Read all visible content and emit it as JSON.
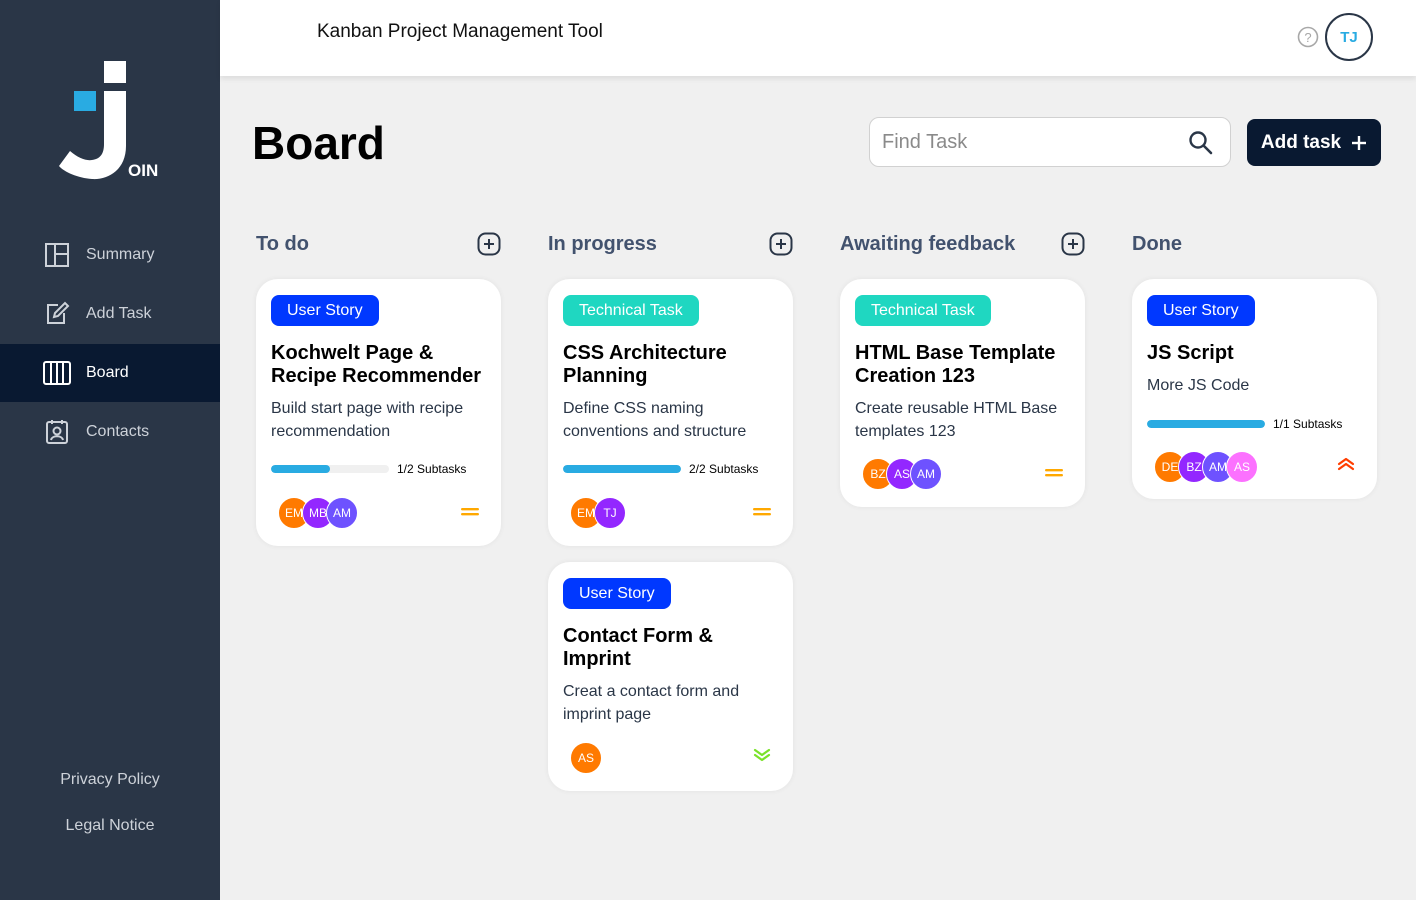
{
  "app": {
    "title": "Kanban Project Management Tool",
    "logo_text": "OIN",
    "user_initials": "TJ"
  },
  "sidebar": {
    "items": [
      {
        "label": "Summary",
        "icon": "summary-icon"
      },
      {
        "label": "Add Task",
        "icon": "edit-icon"
      },
      {
        "label": "Board",
        "icon": "board-icon",
        "active": true
      },
      {
        "label": "Contacts",
        "icon": "contacts-icon"
      }
    ],
    "footer": [
      "Privacy Policy",
      "Legal Notice"
    ]
  },
  "board": {
    "title": "Board",
    "search_placeholder": "Find Task",
    "add_task_label": "Add task"
  },
  "columns": [
    {
      "title": "To do"
    },
    {
      "title": "In progress"
    },
    {
      "title": "Awaiting feedback"
    },
    {
      "title": "Done"
    }
  ],
  "cards": [
    {
      "category": "User Story",
      "title": "Kochwelt Page & Recipe Recommender",
      "description": "Build start page with recipe recommendation",
      "subtasks_done": 1,
      "subtasks_total": 2,
      "subtasks_label": "1/2 Subtasks",
      "avatars": [
        "EM",
        "MB",
        "AM"
      ],
      "priority": "medium"
    },
    {
      "category": "Technical Task",
      "title": "CSS Architecture Planning",
      "description": "Define CSS naming conventions and structure",
      "subtasks_done": 2,
      "subtasks_total": 2,
      "subtasks_label": "2/2 Subtasks",
      "avatars": [
        "EM",
        "TJ"
      ],
      "priority": "medium"
    },
    {
      "category": "User Story",
      "title": "Contact Form & Imprint",
      "description": "Creat a contact form and imprint page",
      "avatars": [
        "AS"
      ],
      "priority": "low"
    },
    {
      "category": "Technical Task",
      "title": "HTML Base Template Creation 123",
      "description": "Create reusable HTML Base templates 123",
      "avatars": [
        "BZ",
        "AS",
        "AM"
      ],
      "priority": "medium"
    },
    {
      "category": "User Story",
      "title": "JS Script",
      "description": "More JS Code",
      "subtasks_done": 1,
      "subtasks_total": 1,
      "subtasks_label": "1/1 Subtasks",
      "avatars": [
        "DE",
        "BZ",
        "AM",
        "AS"
      ],
      "priority": "urgent"
    }
  ],
  "colors": {
    "sidebar": "#2a3647",
    "active_nav": "#091931",
    "user_story": "#0038ff",
    "technical_task": "#1fd7c1",
    "progress": "#29abe2",
    "prio_medium": "#ffa800",
    "prio_low": "#7ae229",
    "prio_urgent": "#ff3d00"
  }
}
